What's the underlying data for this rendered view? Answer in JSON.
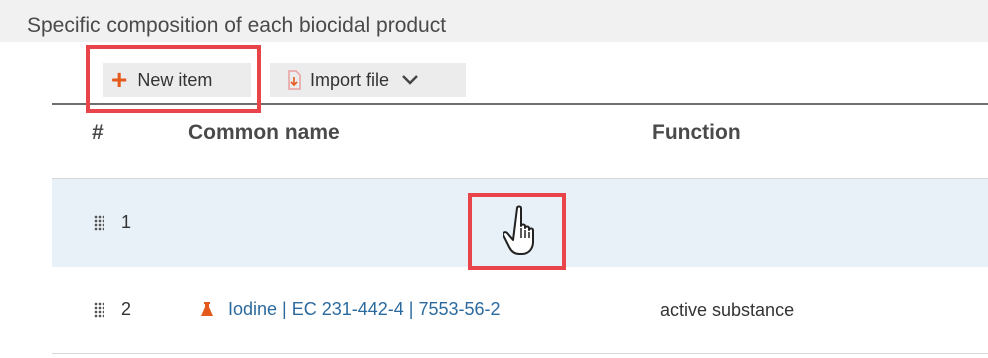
{
  "section": {
    "title": "Specific composition of each biocidal product"
  },
  "toolbar": {
    "new_item_label": "New item",
    "import_file_label": "Import file"
  },
  "table": {
    "columns": {
      "index": "#",
      "common_name": "Common name",
      "function": "Function"
    },
    "rows": [
      {
        "number": "1",
        "common_name": "",
        "function": ""
      },
      {
        "number": "2",
        "common_name": "Iodine | EC 231-442-4 | 7553-56-2",
        "function": "active substance"
      }
    ]
  },
  "colors": {
    "accent_orange": "#e35a1c",
    "link_blue": "#2c6a9e",
    "highlight_red": "#e8444a",
    "selected_row": "#e8f1f8"
  },
  "icons": [
    "plus-icon",
    "import-file-icon",
    "chevron-down-icon",
    "drag-handle-icon",
    "flask-icon",
    "hand-cursor-icon"
  ]
}
